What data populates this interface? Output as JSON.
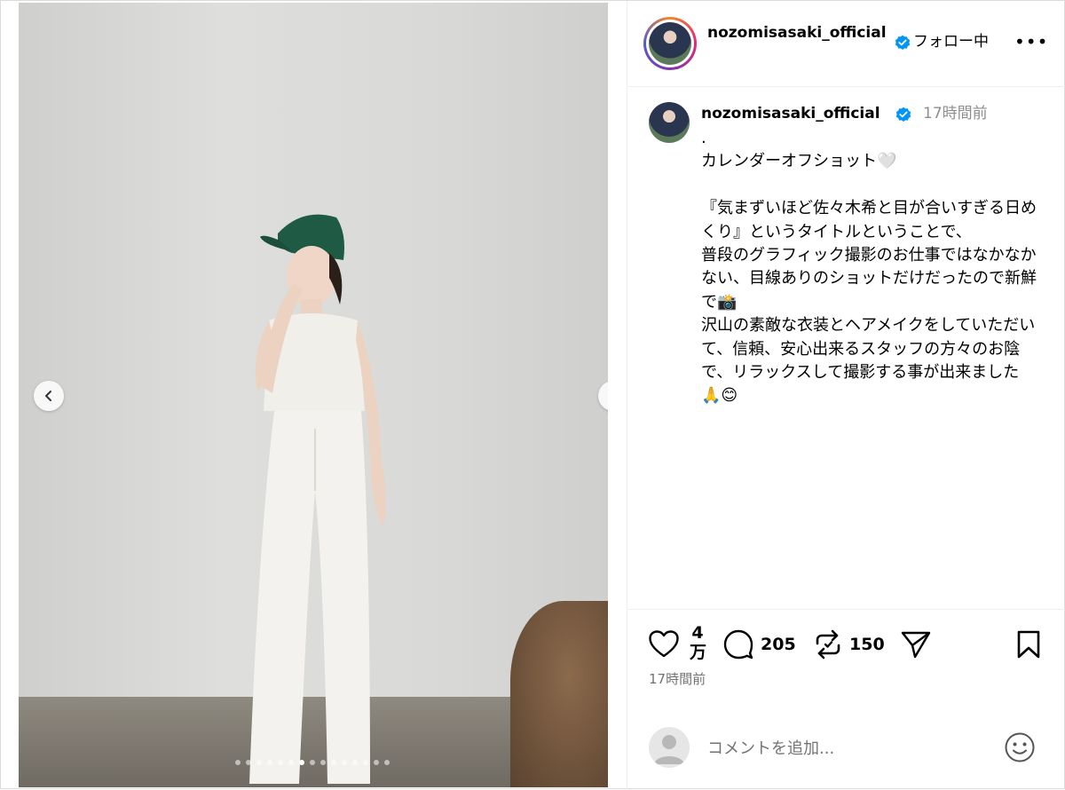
{
  "post": {
    "username": "nozomisasaki_official",
    "follow_status": "フォロー中",
    "more_label": "•••",
    "time_ago": "17時間前",
    "caption": ".\nカレンダーオフショット🤍\n\n『気まずいほど佐々木希と目が合いすぎる日めくり』というタイトルということで、\n普段のグラフィック撮影のお仕事ではなかなかない、目線ありのショットだけだったので新鮮で📸\n沢山の素敵な衣装とヘアメイクをしていただいて、信頼、安心出来るスタッフの方々のお陰で、リラックスして撮影する事が出来ました🙏😊"
  },
  "actions": {
    "likes": "4\n万",
    "comments": "205",
    "reposts": "150",
    "timestamp": "17時間前"
  },
  "comment_box": {
    "placeholder": "コメントを追加..."
  },
  "carousel": {
    "total": 15,
    "active_index": 6
  },
  "icons": {
    "verified": "verified-badge-icon",
    "like": "heart-icon",
    "comment": "comment-bubble-icon",
    "repost": "repost-icon",
    "share": "share-paper-plane-icon",
    "save": "bookmark-icon",
    "emoji": "emoji-smile-icon",
    "prev": "chevron-left-icon",
    "next": "chevron-right-icon"
  },
  "colors": {
    "verified_blue": "#0095f6",
    "muted_text": "#737373",
    "border": "#efefef"
  }
}
